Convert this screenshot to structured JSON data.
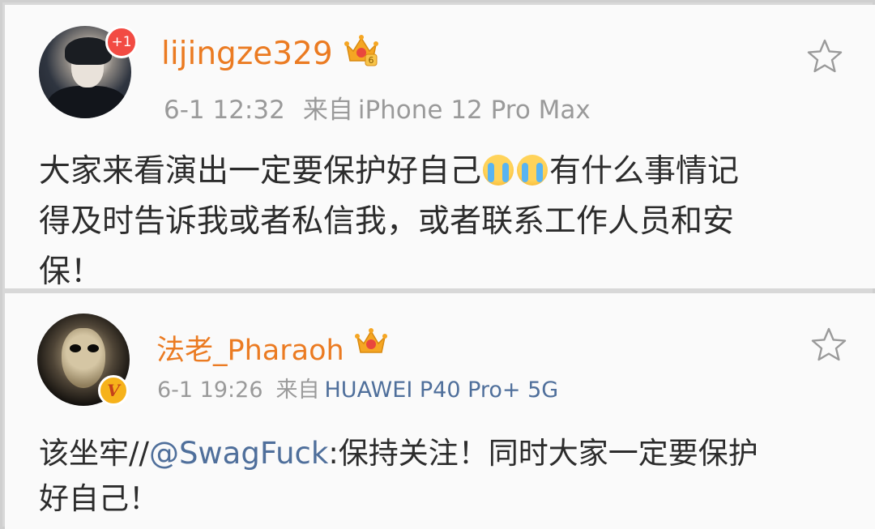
{
  "posts": [
    {
      "username": "lijingze329",
      "avatar_badge": "+1",
      "crown_level": "6",
      "time": "6-1 12:32",
      "source_label": "来自",
      "device": "iPhone 12 Pro Max",
      "body_line1_a": "大家来看演出一定要保护好自己",
      "body_line1_b": "有什么事情记",
      "body_line2": "得及时告诉我或者私信我，或者联系工作人员和安",
      "body_line3": "保！"
    },
    {
      "username": "法老_Pharaoh",
      "verified_badge": "V",
      "time": "6-1 19:26",
      "source_label": "来自",
      "device": "HUAWEI P40 Pro+ 5G",
      "body_prefix": "该坐牢//",
      "mention": "@SwagFuck",
      "body_suffix": ":保持关注！同时大家一定要保护",
      "body_line2": "好自己！"
    }
  ],
  "icons": {
    "favorite": "star-outline-icon",
    "emoji": "crying-face-emoji",
    "crown": "vip-crown-icon"
  },
  "colors": {
    "username": "#eb7b22",
    "meta": "#9a9a9a",
    "link": "#4f6f9b",
    "badge_red": "#f24b43"
  }
}
